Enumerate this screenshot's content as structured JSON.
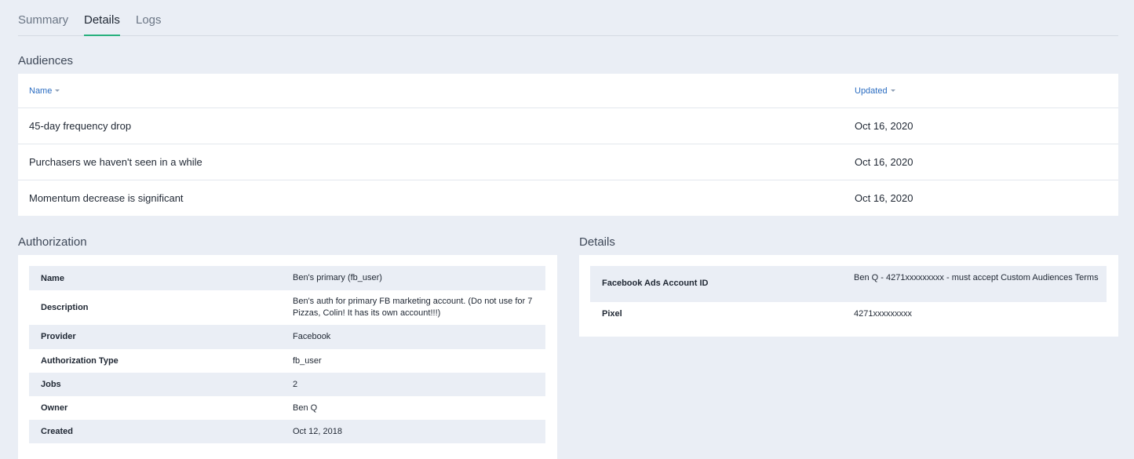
{
  "tabs": [
    {
      "label": "Summary",
      "active": false
    },
    {
      "label": "Details",
      "active": true
    },
    {
      "label": "Logs",
      "active": false
    }
  ],
  "accent_color": "#27b07c",
  "audiences": {
    "title": "Audiences",
    "columns": {
      "name": "Name",
      "updated": "Updated"
    },
    "rows": [
      {
        "name": "45-day frequency drop",
        "updated": "Oct 16, 2020"
      },
      {
        "name": "Purchasers we haven't seen in a while",
        "updated": "Oct 16, 2020"
      },
      {
        "name": "Momentum decrease is significant",
        "updated": "Oct 16, 2020"
      }
    ]
  },
  "authorization": {
    "title": "Authorization",
    "rows": [
      {
        "key": "Name",
        "value": "Ben's primary (fb_user)"
      },
      {
        "key": "Description",
        "value": "Ben's auth for primary FB marketing account. (Do not use for 7 Pizzas, Colin! It has its own account!!!)"
      },
      {
        "key": "Provider",
        "value": "Facebook"
      },
      {
        "key": "Authorization Type",
        "value": "fb_user"
      },
      {
        "key": "Jobs",
        "value": "2"
      },
      {
        "key": "Owner",
        "value": "Ben Q"
      },
      {
        "key": "Created",
        "value": "Oct 12, 2018"
      }
    ]
  },
  "details": {
    "title": "Details",
    "rows": [
      {
        "key": "Facebook Ads Account ID",
        "value": "Ben Q - 4271xxxxxxxxx - must accept Custom Audiences Terms"
      },
      {
        "key": "Pixel",
        "value": "4271xxxxxxxxx"
      }
    ]
  }
}
